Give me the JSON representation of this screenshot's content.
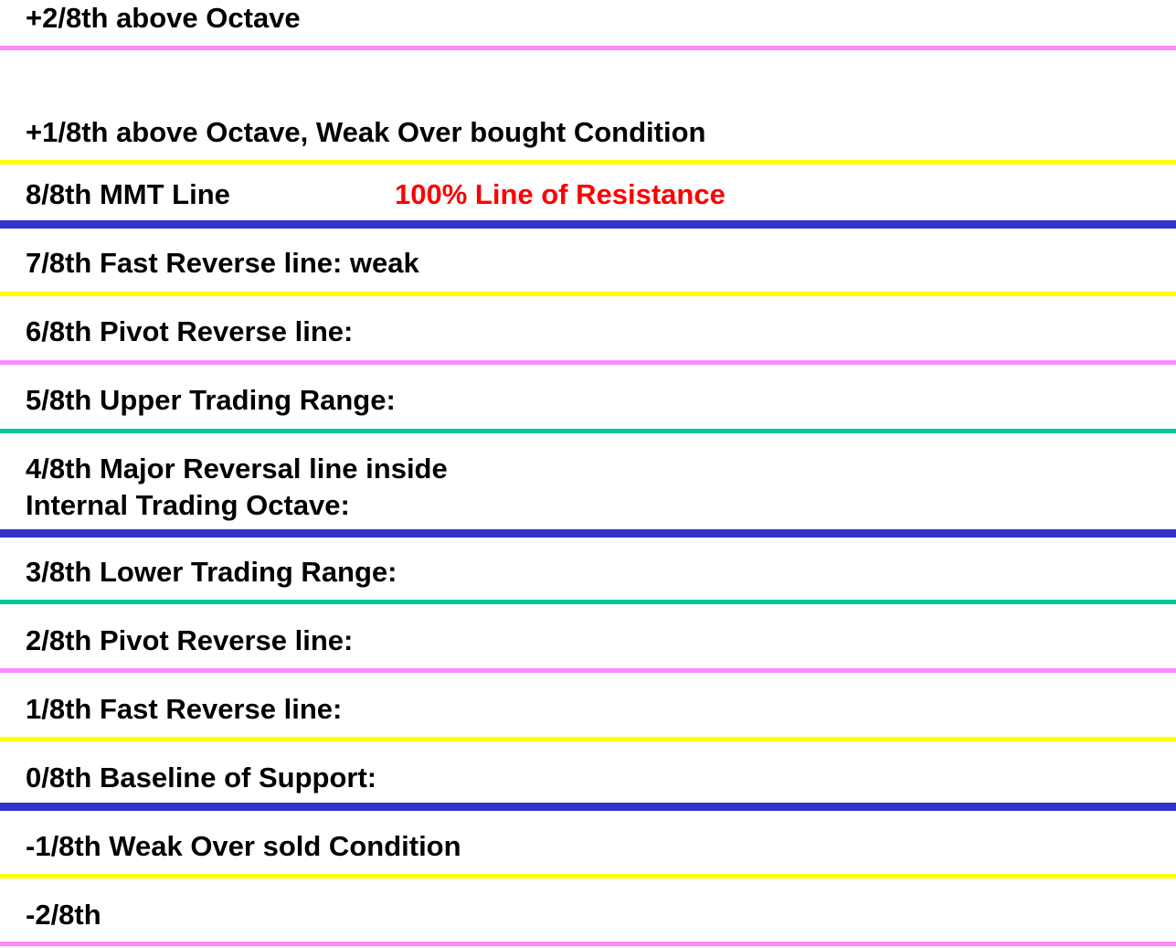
{
  "levels": [
    {
      "label": "+2/8th above Octave",
      "color": "#FF88FF"
    },
    {
      "label": "+1/8th above Octave, Weak Over bought Condition",
      "color": "#FFFF00"
    },
    {
      "label": "8/8th MMT Line",
      "color": "#3333CC",
      "note": "100% Line of Resistance",
      "note_color": "#FF0000"
    },
    {
      "label": "7/8th Fast Reverse line: weak",
      "color": "#FFFF00"
    },
    {
      "label": "6/8th Pivot Reverse line:",
      "color": "#FF88FF"
    },
    {
      "label": "5/8th Upper Trading Range:",
      "color": "#00C896"
    },
    {
      "label": "4/8th Major Reversal line inside",
      "label2": "Internal Trading Octave:",
      "color": "#3333CC"
    },
    {
      "label": "3/8th Lower Trading Range:",
      "color": "#00C896"
    },
    {
      "label": "2/8th Pivot Reverse line:",
      "color": "#FF88FF"
    },
    {
      "label": "1/8th Fast Reverse line:",
      "color": "#FFFF00"
    },
    {
      "label": "0/8th Baseline of Support:",
      "color": "#3333CC"
    },
    {
      "label": "-1/8th Weak Over sold Condition",
      "color": "#FFFF00"
    },
    {
      "label": "-2/8th",
      "color": "#FF88FF"
    }
  ]
}
